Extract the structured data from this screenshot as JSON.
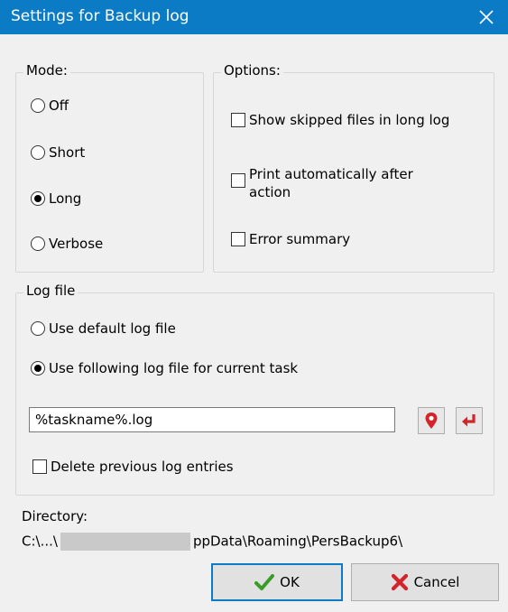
{
  "window": {
    "title": "Settings for Backup log"
  },
  "mode": {
    "label": "Mode:",
    "options": [
      {
        "label": "Off",
        "checked": false
      },
      {
        "label": "Short",
        "checked": false
      },
      {
        "label": "Long",
        "checked": true
      },
      {
        "label": "Verbose",
        "checked": false
      }
    ]
  },
  "options": {
    "label": "Options:",
    "items": [
      {
        "label": "Show skipped files in long log",
        "checked": false
      },
      {
        "label_line1": "Print automatically after",
        "label_line2": "action",
        "checked": false
      },
      {
        "label": "Error summary",
        "checked": false
      }
    ]
  },
  "logfile": {
    "label": "Log file",
    "default_label": "Use default log file",
    "default_checked": false,
    "custom_label": "Use following log file for current task",
    "custom_checked": true,
    "value": "%taskname%.log",
    "delete_label": "Delete previous log entries",
    "delete_checked": false
  },
  "directory": {
    "label": "Directory:",
    "path_start": "C:\\...\\",
    "path_end": "ppData\\Roaming\\PersBackup6\\"
  },
  "buttons": {
    "ok": "OK",
    "cancel": "Cancel"
  },
  "colors": {
    "titlebar": "#0c7bc6",
    "ok_icon": "#3a9b26",
    "cancel_icon": "#d3232b",
    "pin_icon": "#d3232b"
  },
  "icons": {
    "locate": "map-pin-icon",
    "apply": "return-arrow-icon"
  }
}
